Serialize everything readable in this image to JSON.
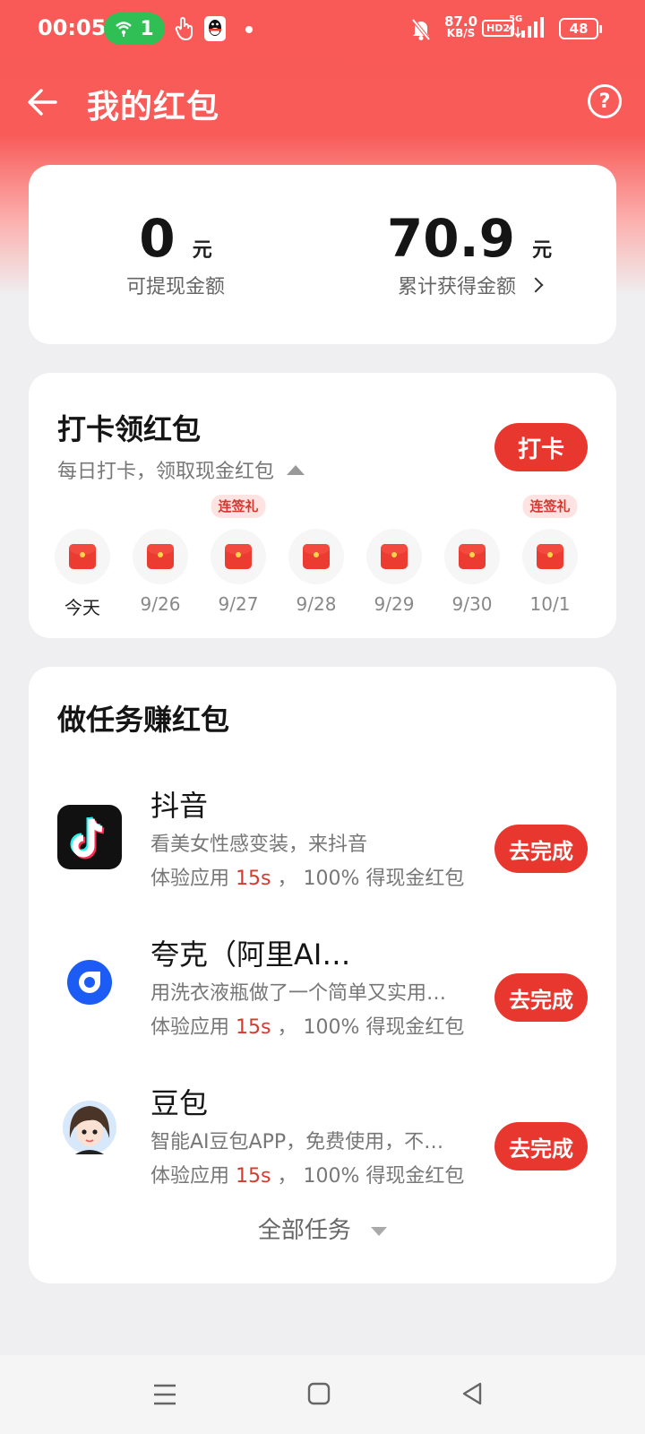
{
  "status_bar": {
    "time": "00:05",
    "hotspot_count": "1",
    "net_speed_value": "87.0",
    "net_speed_unit": "KB/S",
    "hd_label": "HD2",
    "signal_label": "5G",
    "battery": "48"
  },
  "header": {
    "title": "我的红包"
  },
  "balance": {
    "withdrawable_amount": "0",
    "withdrawable_unit": "元",
    "withdrawable_label": "可提现金额",
    "total_amount": "70.9",
    "total_unit": "元",
    "total_label": "累计获得金额"
  },
  "checkin": {
    "title": "打卡领红包",
    "subtitle": "每日打卡，领取现金红包",
    "button_label": "打卡",
    "days": [
      {
        "label": "今天",
        "badge": ""
      },
      {
        "label": "9/26",
        "badge": ""
      },
      {
        "label": "9/27",
        "badge": "连签礼"
      },
      {
        "label": "9/28",
        "badge": ""
      },
      {
        "label": "9/29",
        "badge": ""
      },
      {
        "label": "9/30",
        "badge": ""
      },
      {
        "label": "10/1",
        "badge": "连签礼"
      }
    ]
  },
  "tasks": {
    "title": "做任务赚红包",
    "items": [
      {
        "name": "抖音",
        "desc": "看美女性感变装，来抖音",
        "reward_prefix": "体验应用 ",
        "reward_time": "15s",
        "reward_suffix": " ， 100% 得现金红包",
        "button": "去完成",
        "icon": "douyin-icon"
      },
      {
        "name": "夸克（阿里AI…",
        "desc": "用洗衣液瓶做了一个简单又实用…",
        "reward_prefix": "体验应用 ",
        "reward_time": "15s",
        "reward_suffix": " ， 100% 得现金红包",
        "button": "去完成",
        "icon": "quark-icon"
      },
      {
        "name": "豆包",
        "desc": "智能AI豆包APP，免费使用，不…",
        "reward_prefix": "体验应用 ",
        "reward_time": "15s",
        "reward_suffix": " ， 100% 得现金红包",
        "button": "去完成",
        "icon": "doubao-icon"
      }
    ],
    "all_tasks_label": "全部任务"
  },
  "colors": {
    "accent": "#e8372f",
    "header_bg": "#f95a57",
    "page_bg": "#efeff1"
  }
}
